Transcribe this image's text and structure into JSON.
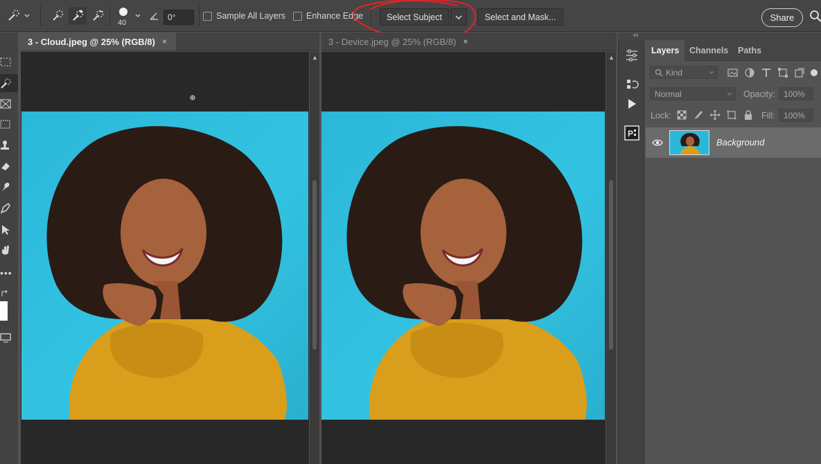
{
  "options_bar": {
    "brush_size": "40",
    "angle_value": "0°",
    "sample_all_layers_label": "Sample All Layers",
    "enhance_edge_label": "Enhance Edge",
    "select_subject_label": "Select Subject",
    "select_and_mask_label": "Select and Mask...",
    "share_label": "Share"
  },
  "documents": [
    {
      "title": "3 - Cloud.jpeg @ 25% (RGB/8)",
      "close": "×",
      "active": true
    },
    {
      "title": "3 - Device.jpeg @ 25% (RGB/8)",
      "close": "×",
      "active": false
    }
  ],
  "layers_panel": {
    "tabs": [
      "Layers",
      "Channels",
      "Paths"
    ],
    "active_tab": "Layers",
    "filter_placeholder": "Kind",
    "blend_mode": "Normal",
    "opacity_label": "Opacity:",
    "opacity_value": "100%",
    "lock_label": "Lock:",
    "fill_label": "Fill:",
    "fill_value": "100%",
    "layers": [
      {
        "name": "Background",
        "visible": true
      }
    ]
  },
  "dock": {
    "collapse_glyph": "‹‹"
  },
  "colors": {
    "photo_bg": "#2bb7d8",
    "sweater": "#d99e1b",
    "hair": "#2a1b14",
    "skin": "#a5623c",
    "annotation_red": "#d6262b"
  }
}
